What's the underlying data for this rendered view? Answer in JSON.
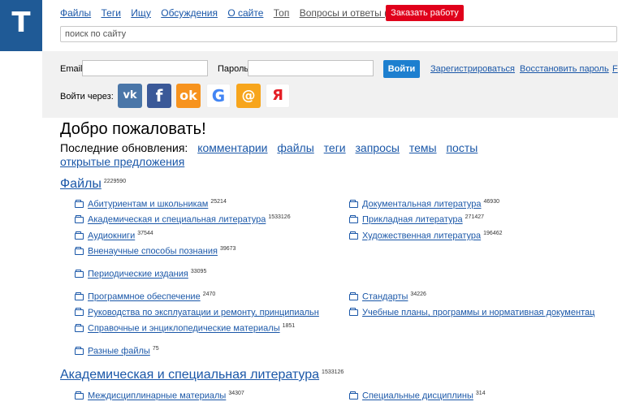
{
  "logo": "T",
  "nav": [
    "Файлы",
    "Теги",
    "Ищу",
    "Обсуждения",
    "О сайте",
    "Топ",
    "Вопросы и ответы (FAQ)"
  ],
  "order_button": "Заказать работу",
  "search_placeholder": "поиск по сайту",
  "login": {
    "email_label": "Email",
    "password_label": "Пароль",
    "login_button": "Войти",
    "register": "Зарегистрироваться",
    "restore": "Восстановить пароль",
    "cut": "F",
    "via_label": "Войти через:",
    "social": [
      "vk-icon",
      "facebook-icon",
      "odnoklassniki-icon",
      "google-icon",
      "mailru-icon",
      "yandex-icon"
    ]
  },
  "welcome": "Добро пожаловать!",
  "updates": {
    "label": "Последние обновления:",
    "links": [
      "комментарии",
      "файлы",
      "теги",
      "запросы",
      "темы",
      "посты",
      "открытые предложения"
    ]
  },
  "files_section": {
    "title": "Файлы",
    "count": "2229590",
    "left": [
      {
        "label": "Абитуриентам и школьникам",
        "count": "25214"
      },
      {
        "label": "Академическая и специальная литература",
        "count": "1533126"
      },
      {
        "label": "Аудиокниги",
        "count": "37544"
      },
      {
        "label": "Вненаучные способы познания",
        "count": "39673"
      },
      {
        "label": "Периодические издания",
        "count": "33095"
      },
      {
        "label": "Программное обеспечение",
        "count": "2470"
      },
      {
        "label": "Руководства по эксплуатации и ремонту, принципиальн",
        "count": ""
      },
      {
        "label": "Справочные и энциклопедические материалы",
        "count": "1851"
      },
      {
        "label": "Разные файлы",
        "count": "75"
      }
    ],
    "right": [
      {
        "label": "Документальная литература",
        "count": "46930"
      },
      {
        "label": "Прикладная литература",
        "count": "271427"
      },
      {
        "label": "Художественная литература",
        "count": "196462"
      },
      {
        "label": "Стандарты",
        "count": "34226"
      },
      {
        "label": "Учебные планы, программы и нормативная документац",
        "count": ""
      }
    ]
  },
  "academic_section": {
    "title": "Академическая и специальная литература",
    "count": "1533126",
    "left": [
      {
        "label": "Междисциплинарные материалы",
        "count": "34307"
      }
    ],
    "right": [
      {
        "label": "Специальные дисциплины",
        "count": "314"
      }
    ]
  }
}
